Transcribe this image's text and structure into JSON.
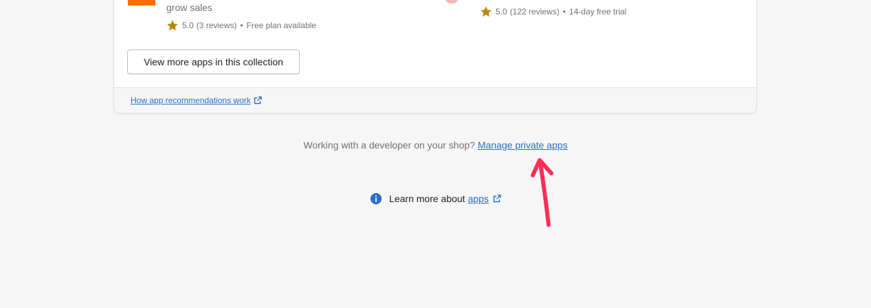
{
  "apps": {
    "left": {
      "description": "grow sales",
      "rating": "5.0",
      "reviews": "(3 reviews)",
      "pricing": "Free plan available"
    },
    "right": {
      "rating": "5.0",
      "reviews": "(122 reviews)",
      "pricing": "14-day free trial"
    },
    "separator": "•"
  },
  "card": {
    "view_more_label": "View more apps in this collection",
    "footer_link": "How app recommendations work"
  },
  "developer": {
    "prompt": "Working with a developer on your shop?",
    "link": "Manage private apps"
  },
  "learn_more": {
    "text": "Learn more about",
    "link": "apps"
  },
  "colors": {
    "accent": "#2c6ecb",
    "star": "#b98900",
    "annotation_arrow": "#ff2d55"
  },
  "icons": {
    "star": "star-icon",
    "external": "external-link-icon",
    "info": "info-icon"
  }
}
